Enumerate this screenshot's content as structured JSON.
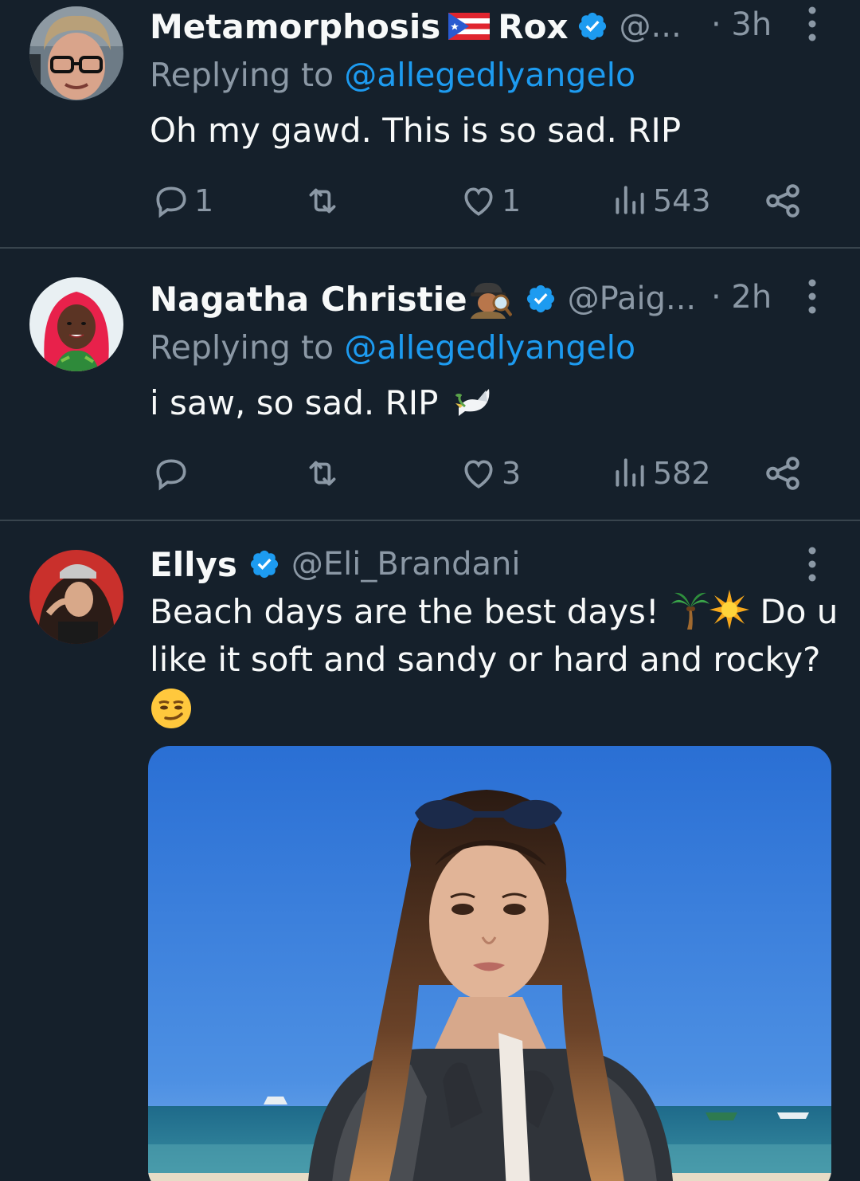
{
  "tweets": [
    {
      "display_name": "Metamorphosis",
      "display_name_suffix": "Rox",
      "flag": "puerto-rico-flag",
      "handle": "@...",
      "time": "· 3h",
      "replying_prefix": "Replying to ",
      "replying_to": "@allegedlyangelo",
      "text": "Oh my gawd. This is so sad. RIP",
      "replies": "1",
      "retweets": "",
      "likes": "1",
      "views": "543"
    },
    {
      "display_name": "Nagatha Christie",
      "emoji": "detective-emoji",
      "handle": "@Paig...",
      "time": "· 2h",
      "replying_prefix": "Replying to ",
      "replying_to": "@allegedlyangelo",
      "text": "i saw, so sad. RIP",
      "text_emoji": "dove-emoji",
      "replies": "",
      "retweets": "",
      "likes": "3",
      "views": "582"
    },
    {
      "display_name": "Ellys",
      "handle": "@Eli_Brandani",
      "text_line1": "Beach days are the best days!",
      "text_line1_end": "Do u",
      "text_line2": "like it soft and sandy or hard and rocky?",
      "emojis": [
        "palm-tree-emoji",
        "sun-emoji",
        "smirk-emoji"
      ],
      "media": "beach-photo"
    }
  ],
  "colors": {
    "background": "#15202b",
    "divider": "#38444d",
    "secondary_text": "#8b98a5",
    "link": "#1d9bf0",
    "verified": "#1d9bf0"
  }
}
